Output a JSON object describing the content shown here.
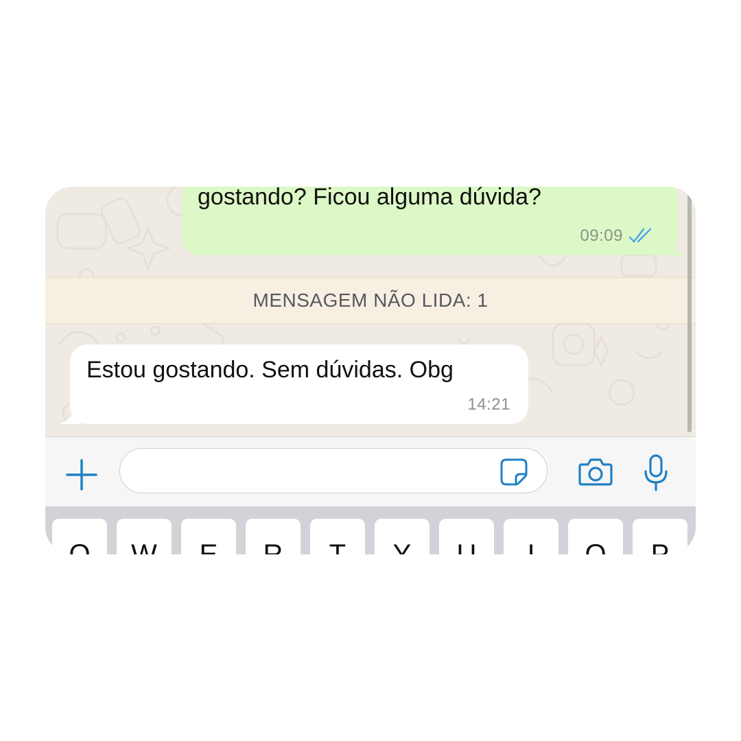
{
  "chat": {
    "outgoing": {
      "text": "gostando? Ficou alguma dúvida?",
      "time": "09:09",
      "status_icon": "double-check-icon",
      "bubble_color": "#dcf8c6",
      "check_color": "#4fa6e8"
    },
    "unread_label": "MENSAGEM NÃO LIDA: 1",
    "incoming": {
      "text": "Estou gostando. Sem dúvidas. Obg",
      "time": "14:21",
      "bubble_color": "#ffffff"
    }
  },
  "input_bar": {
    "attach_icon": "plus-icon",
    "message_placeholder": "",
    "sticker_icon": "sticker-icon",
    "camera_icon": "camera-icon",
    "mic_icon": "microphone-icon",
    "accent_color": "#1f80c4"
  },
  "keyboard": {
    "keys": [
      "Q",
      "W",
      "E",
      "R",
      "T",
      "Y",
      "U",
      "I",
      "O",
      "P"
    ]
  }
}
